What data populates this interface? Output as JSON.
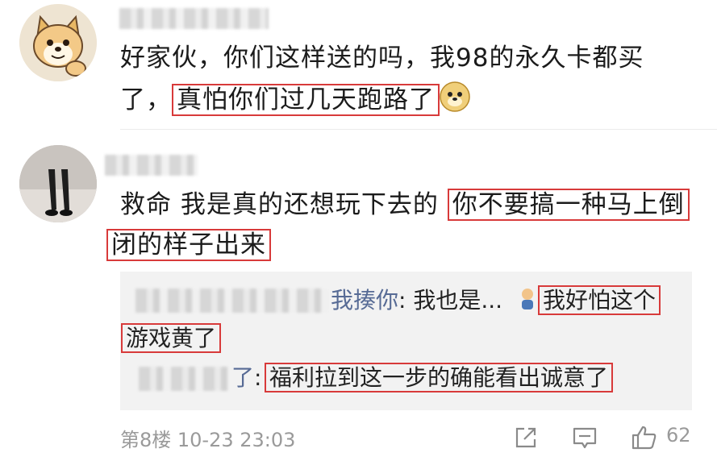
{
  "comments": [
    {
      "line1": "好家伙，你们这样送的吗，我98的永久卡都买",
      "line2_pre": "了，",
      "line2_highlight": "真怕你们过几天跑路了"
    },
    {
      "line1_pre": "救命 我是真的还想玩下去的 ",
      "line1_highlight": "你不要搞一种马上倒",
      "line2_highlight": "闭的样子出来"
    }
  ],
  "replies": [
    {
      "author": "我揍你",
      "colon": ": ",
      "text": "我也是... ",
      "highlight_a": "我好怕这个",
      "highlight_b": "游戏黄了"
    },
    {
      "author": "了",
      "colon": ": ",
      "highlight": "福利拉到这一步的确能看出诚意了"
    }
  ],
  "footer": {
    "floor_time": "第8楼 10-23 23:03",
    "likes": "62"
  },
  "colors": {
    "highlight_border": "#d83a3a",
    "link": "#576b95",
    "meta": "#9a9a9a"
  },
  "icons": [
    "share-icon",
    "comment-icon",
    "thumbs-up-icon",
    "doge-emoji-icon",
    "man-emoji-icon"
  ]
}
